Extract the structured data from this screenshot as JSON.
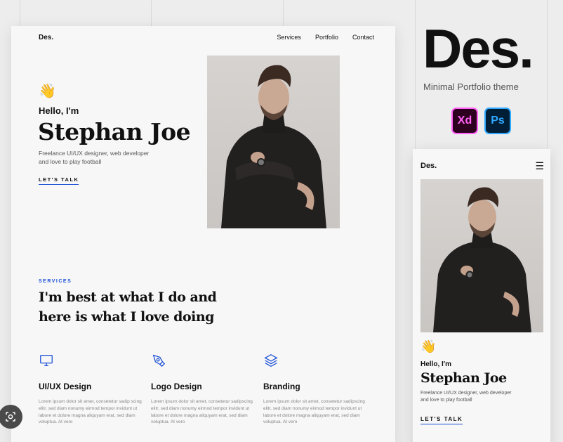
{
  "desktop": {
    "nav": {
      "logo": "Des.",
      "links": [
        "Services",
        "Portfolio",
        "Contact"
      ]
    },
    "hero": {
      "wave": "👋",
      "hello": "Hello, I'm",
      "name": "Stephan Joe",
      "tagline_line1": "Freelance UI/UX designer, web developer",
      "tagline_line2": "and love to play football",
      "cta": "LET'S TALK"
    },
    "services": {
      "label": "SERVICES",
      "title_line1": "I'm best at what I do and",
      "title_line2": "here is what I love doing",
      "items": [
        {
          "title": "UI/UX Design",
          "icon": "monitor-icon",
          "text": "Lorem ipsum dolor sit amet, consetetur sadip scing elitr, sed diam nonumy eirmod tempor invidunt ut labore et dolore magna aliquyam erat, sed diam voluptua. At vero"
        },
        {
          "title": "Logo Design",
          "icon": "pen-tool-icon",
          "text": "Lorem ipsum dolor sit amet, consetetur sadipscing elitr, sed diam nonumy eirmod tempor invidunt ut labore et dolore magna aliquyam erat, sed diam voluptua. At vero"
        },
        {
          "title": "Branding",
          "icon": "layers-icon",
          "text": "Lorem ipsum dolor sit amet, consetetur sadipscing elitr, sed diam nonumy eirmod tempor invidunt ut labore et dolore magna aliquyam erat, sed diam voluptua. At vero"
        }
      ]
    }
  },
  "brand": {
    "logo": "Des.",
    "subtitle": "Minimal Portfolio theme",
    "xd_label": "Xd",
    "ps_label": "Ps"
  },
  "mobile": {
    "logo": "Des.",
    "menu_icon": "☰",
    "wave": "👋",
    "hello": "Hello, I'm",
    "name": "Stephan Joe",
    "tagline_line1": "Freelance UI/UX designer, web developer",
    "tagline_line2": "and love to play football",
    "cta": "LET'S TALK"
  },
  "colors": {
    "accent": "#1a4fd6",
    "xd_bg": "#2e001f",
    "xd_fg": "#ff61f6",
    "ps_bg": "#001e36",
    "ps_fg": "#31a8ff"
  }
}
